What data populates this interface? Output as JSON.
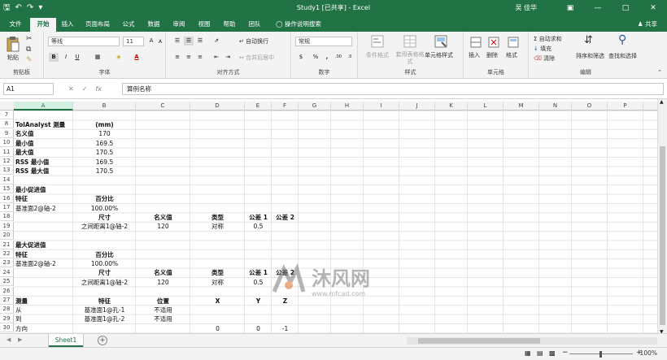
{
  "titlebar": {
    "title": "Study1 [已共享] - Excel",
    "user": "吴 佳华",
    "quick_access": [
      "save-icon",
      "undo-icon",
      "redo-icon",
      "customize-icon"
    ]
  },
  "tabs": [
    "文件",
    "开始",
    "插入",
    "页面布局",
    "公式",
    "数据",
    "审阅",
    "视图",
    "帮助",
    "团队",
    "操作说明搜索"
  ],
  "active_tab": "开始",
  "share_label": "共享",
  "ribbon": {
    "clipboard": {
      "paste": "粘贴",
      "label": "剪贴板"
    },
    "font": {
      "name": "等线",
      "size": "11",
      "bold": "B",
      "italic": "I",
      "underline": "U",
      "grow": "A",
      "shrink": "A",
      "label": "字体"
    },
    "alignment": {
      "wrap": "自动换行",
      "merge": "合并后居中",
      "label": "对齐方式"
    },
    "number": {
      "format": "常规",
      "currency": "$",
      "percent": "%",
      "comma": ",",
      "label": "数字"
    },
    "styles": {
      "conditional": "条件格式",
      "table": "套用表格格式",
      "cell": "单元格样式",
      "label": "样式"
    },
    "cells": {
      "insert": "插入",
      "delete": "删除",
      "format": "格式",
      "label": "单元格"
    },
    "editing": {
      "autosum": "自动求和",
      "fill": "填充",
      "clear": "清除",
      "sort": "排序和筛选",
      "find": "查找和选择",
      "label": "编辑"
    }
  },
  "formula_bar": {
    "name_box": "A1",
    "content": "算例名称"
  },
  "columns": [
    "A",
    "B",
    "C",
    "D",
    "E",
    "F",
    "G",
    "H",
    "I",
    "J",
    "K",
    "L",
    "M",
    "N",
    "O",
    "P"
  ],
  "rows": [
    "7",
    "8",
    "9",
    "10",
    "11",
    "12",
    "13",
    "14",
    "15",
    "16",
    "17",
    "18",
    "19",
    "20",
    "21",
    "22",
    "23",
    "24",
    "25",
    "26",
    "27",
    "28",
    "29",
    "30"
  ],
  "cells": [
    {
      "r": "8",
      "c": "A",
      "v": "TolAnalyst 测量",
      "b": true
    },
    {
      "r": "8",
      "c": "B",
      "v": "(mm)",
      "b": true,
      "center": true
    },
    {
      "r": "9",
      "c": "A",
      "v": "名义值",
      "b": true
    },
    {
      "r": "9",
      "c": "B",
      "v": "170",
      "center": true
    },
    {
      "r": "10",
      "c": "A",
      "v": "最小值",
      "b": true
    },
    {
      "r": "10",
      "c": "B",
      "v": "169.5",
      "center": true
    },
    {
      "r": "11",
      "c": "A",
      "v": "最大值",
      "b": true
    },
    {
      "r": "11",
      "c": "B",
      "v": "170.5",
      "center": true
    },
    {
      "r": "12",
      "c": "A",
      "v": "RSS 最小值",
      "b": true
    },
    {
      "r": "12",
      "c": "B",
      "v": "169.5",
      "center": true
    },
    {
      "r": "13",
      "c": "A",
      "v": "RSS 最大值",
      "b": true
    },
    {
      "r": "13",
      "c": "B",
      "v": "170.5",
      "center": true
    },
    {
      "r": "15",
      "c": "A",
      "v": "最小促进值",
      "b": true
    },
    {
      "r": "16",
      "c": "A",
      "v": "特征",
      "b": true
    },
    {
      "r": "16",
      "c": "B",
      "v": "百分比",
      "b": true,
      "center": true
    },
    {
      "r": "17",
      "c": "A",
      "v": "基准面2@轴-2"
    },
    {
      "r": "17",
      "c": "B",
      "v": "100.00%",
      "center": true
    },
    {
      "r": "18",
      "c": "B",
      "v": "尺寸",
      "b": true,
      "center": true
    },
    {
      "r": "18",
      "c": "C",
      "v": "名义值",
      "b": true,
      "center": true
    },
    {
      "r": "18",
      "c": "D",
      "v": "类型",
      "b": true,
      "center": true
    },
    {
      "r": "18",
      "c": "E",
      "v": "公差 1",
      "b": true,
      "center": true
    },
    {
      "r": "18",
      "c": "F",
      "v": "公差 2",
      "b": true,
      "center": true
    },
    {
      "r": "19",
      "c": "B",
      "v": "之间距离1@轴-2",
      "center": true
    },
    {
      "r": "19",
      "c": "C",
      "v": "120",
      "center": true
    },
    {
      "r": "19",
      "c": "D",
      "v": "对称",
      "center": true
    },
    {
      "r": "19",
      "c": "E",
      "v": "0.5",
      "center": true
    },
    {
      "r": "21",
      "c": "A",
      "v": "最大促进值",
      "b": true
    },
    {
      "r": "22",
      "c": "A",
      "v": "特征",
      "b": true
    },
    {
      "r": "22",
      "c": "B",
      "v": "百分比",
      "b": true,
      "center": true
    },
    {
      "r": "23",
      "c": "A",
      "v": "基准面2@轴-2"
    },
    {
      "r": "23",
      "c": "B",
      "v": "100.00%",
      "center": true
    },
    {
      "r": "24",
      "c": "B",
      "v": "尺寸",
      "b": true,
      "center": true
    },
    {
      "r": "24",
      "c": "C",
      "v": "名义值",
      "b": true,
      "center": true
    },
    {
      "r": "24",
      "c": "D",
      "v": "类型",
      "b": true,
      "center": true
    },
    {
      "r": "24",
      "c": "E",
      "v": "公差 1",
      "b": true,
      "center": true
    },
    {
      "r": "24",
      "c": "F",
      "v": "公差 2",
      "b": true,
      "center": true
    },
    {
      "r": "25",
      "c": "B",
      "v": "之间距离1@轴-2",
      "center": true
    },
    {
      "r": "25",
      "c": "C",
      "v": "120",
      "center": true
    },
    {
      "r": "25",
      "c": "D",
      "v": "对称",
      "center": true
    },
    {
      "r": "25",
      "c": "E",
      "v": "0.5",
      "center": true
    },
    {
      "r": "27",
      "c": "A",
      "v": "测量",
      "b": true
    },
    {
      "r": "27",
      "c": "B",
      "v": "特征",
      "b": true,
      "center": true
    },
    {
      "r": "27",
      "c": "C",
      "v": "位置",
      "b": true,
      "center": true
    },
    {
      "r": "27",
      "c": "D",
      "v": "X",
      "b": true,
      "center": true
    },
    {
      "r": "27",
      "c": "E",
      "v": "Y",
      "b": true,
      "center": true
    },
    {
      "r": "27",
      "c": "F",
      "v": "Z",
      "b": true,
      "center": true
    },
    {
      "r": "28",
      "c": "A",
      "v": "从"
    },
    {
      "r": "28",
      "c": "B",
      "v": "基准面1@孔-1",
      "center": true
    },
    {
      "r": "28",
      "c": "C",
      "v": "不适用",
      "center": true
    },
    {
      "r": "29",
      "c": "A",
      "v": "到"
    },
    {
      "r": "29",
      "c": "B",
      "v": "基准面1@孔-2",
      "center": true
    },
    {
      "r": "29",
      "c": "C",
      "v": "不适用",
      "center": true
    },
    {
      "r": "30",
      "c": "A",
      "v": "方向"
    },
    {
      "r": "30",
      "c": "D",
      "v": "0",
      "center": true
    },
    {
      "r": "30",
      "c": "E",
      "v": "0",
      "center": true
    },
    {
      "r": "30",
      "c": "F",
      "v": "-1",
      "center": true
    }
  ],
  "watermark": {
    "brand": "沐风网",
    "site": "www.mfcad.com"
  },
  "sheet_tab": "Sheet1",
  "zoom": "100%",
  "colors": {
    "accent": "#217346"
  }
}
